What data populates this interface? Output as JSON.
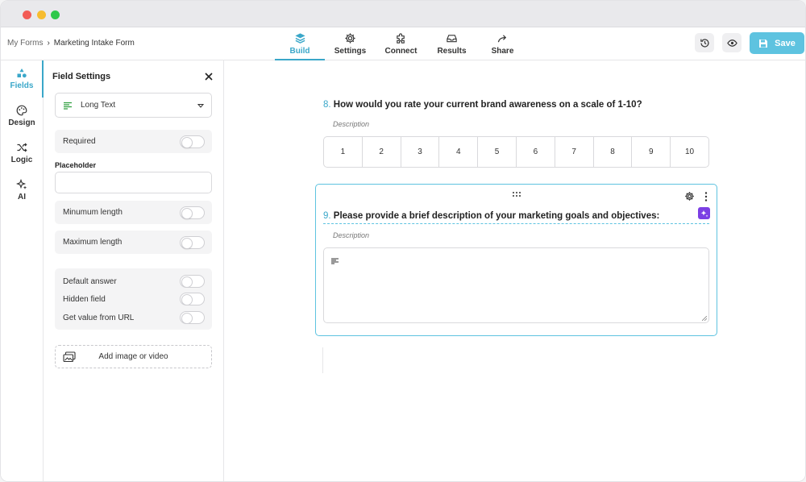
{
  "breadcrumb": {
    "root": "My Forms",
    "separator": "›",
    "current": "Marketing Intake Form"
  },
  "nav_tabs": [
    {
      "label": "Build",
      "icon": "layers-icon",
      "active": true
    },
    {
      "label": "Settings",
      "icon": "gear-icon",
      "active": false
    },
    {
      "label": "Connect",
      "icon": "puzzle-icon",
      "active": false
    },
    {
      "label": "Results",
      "icon": "inbox-icon",
      "active": false
    },
    {
      "label": "Share",
      "icon": "share-arrow-icon",
      "active": false
    }
  ],
  "toolbar": {
    "history_icon": "history-icon",
    "preview_icon": "eye-icon",
    "save_label": "Save"
  },
  "rail": [
    {
      "label": "Fields",
      "icon": "shapes-icon",
      "active": true
    },
    {
      "label": "Design",
      "icon": "palette-icon",
      "active": false
    },
    {
      "label": "Logic",
      "icon": "shuffle-icon",
      "active": false
    },
    {
      "label": "AI",
      "icon": "sparkles-icon",
      "active": false
    }
  ],
  "field_settings": {
    "title": "Field Settings",
    "field_type": "Long Text",
    "required_label": "Required",
    "placeholder_label": "Placeholder",
    "placeholder_value": "",
    "min_length_label": "Minumum length",
    "max_length_label": "Maximum length",
    "default_answer_label": "Default answer",
    "hidden_field_label": "Hidden field",
    "url_value_label": "Get value from URL",
    "add_media_label": "Add image or video"
  },
  "questions": [
    {
      "number": "8.",
      "title": "How would you rate your current brand awareness on a scale of 1-10?",
      "description": "Description",
      "scale": [
        "1",
        "2",
        "3",
        "4",
        "5",
        "6",
        "7",
        "8",
        "9",
        "10"
      ]
    },
    {
      "number": "9.",
      "title": "Please provide a brief description of your marketing goals and objectives:",
      "description": "Description"
    }
  ],
  "colors": {
    "accent": "#3aa7c9",
    "save_button": "#5ec3e0",
    "ai_badge": "#7b3fe4"
  }
}
